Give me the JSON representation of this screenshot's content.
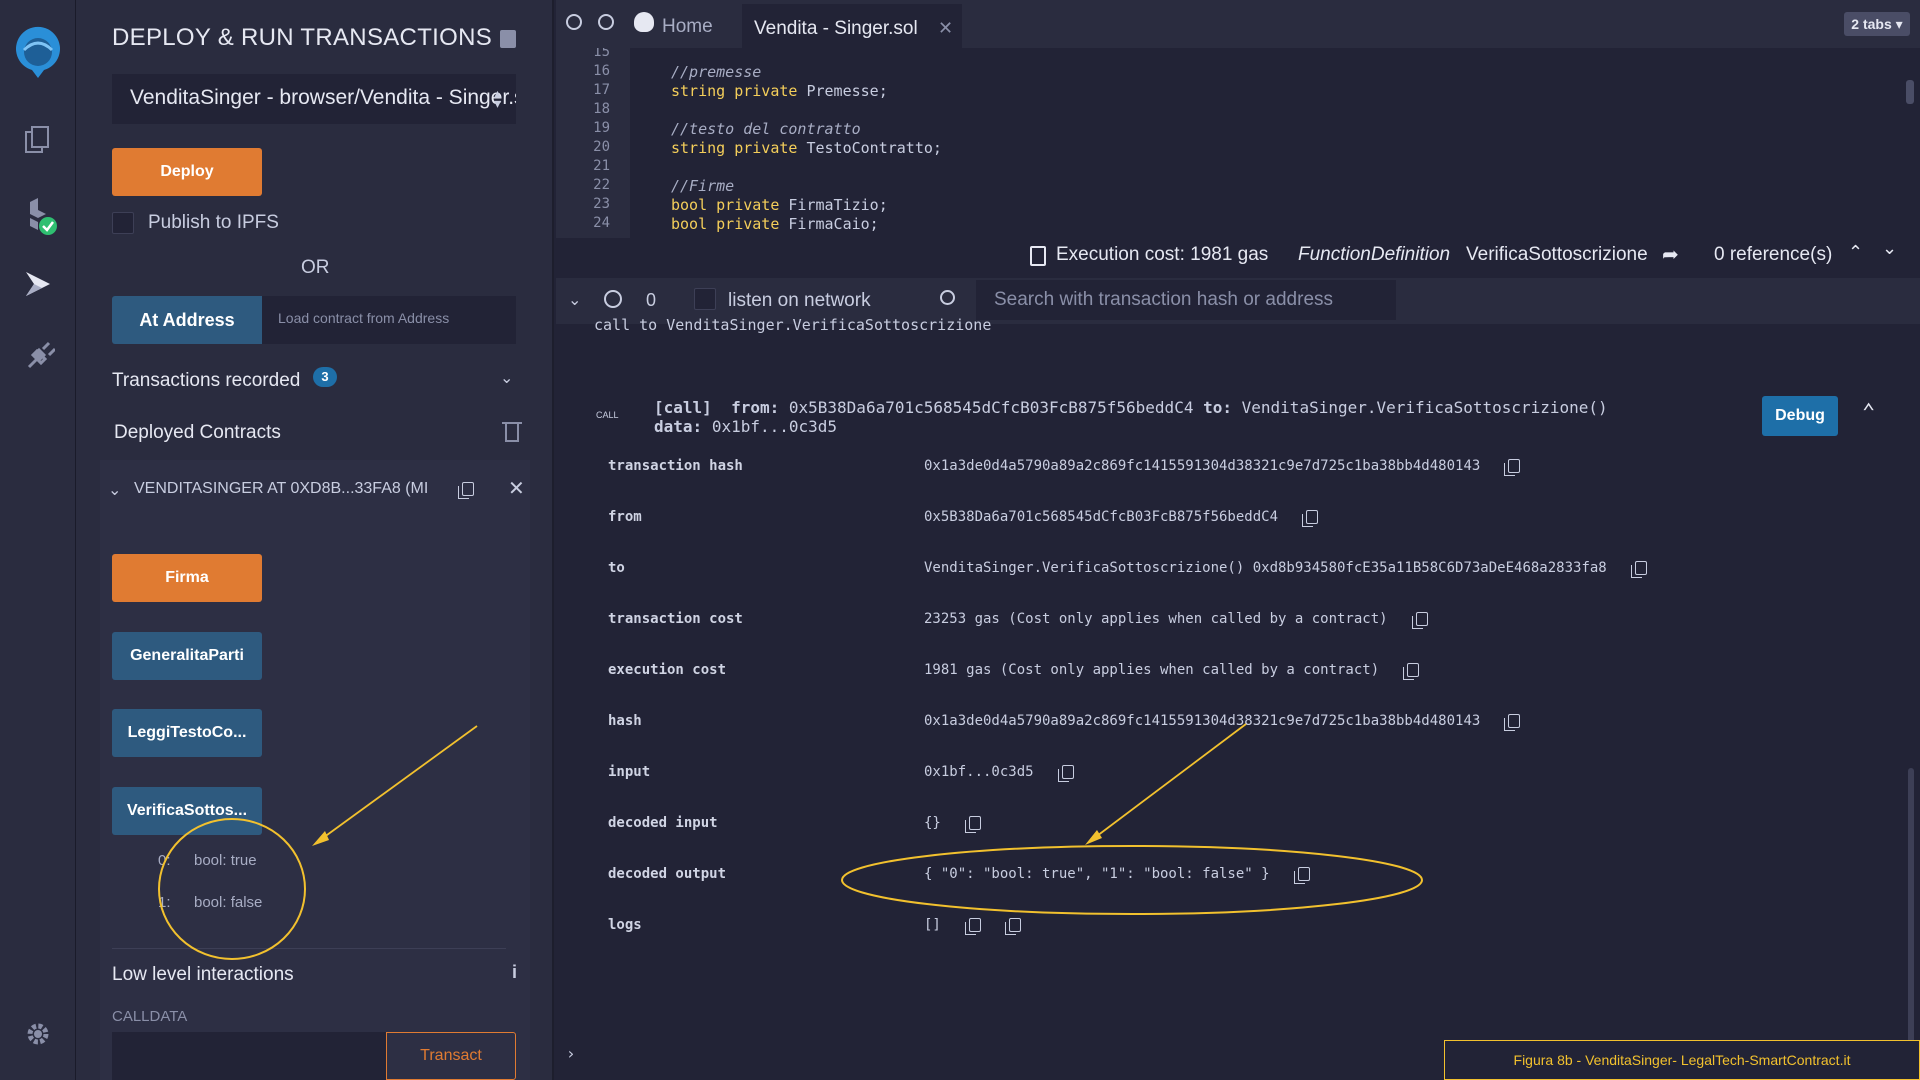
{
  "sidebar_title": "DEPLOY & RUN TRANSACTIONS",
  "contract_select": "VenditaSinger - browser/Vendita - Singer.sol",
  "deploy_label": "Deploy",
  "publish_ipfs_label": "Publish to IPFS",
  "or_label": "OR",
  "at_address_label": "At Address",
  "load_contract_placeholder": "Load contract from Address",
  "transactions_recorded_label": "Transactions recorded",
  "transactions_recorded_count": "3",
  "deployed_contracts_label": "Deployed Contracts",
  "deployed_instance_label": "VENDITASINGER AT 0XD8B...33FA8 (MI",
  "functions": [
    {
      "label": "Firma",
      "style": "orange"
    },
    {
      "label": "GeneralitaParti",
      "style": "blue"
    },
    {
      "label": "LeggiTestoCo...",
      "style": "blue"
    },
    {
      "label": "VerificaSottos...",
      "style": "blue"
    }
  ],
  "results": [
    {
      "index": "0:",
      "value": "bool: true"
    },
    {
      "index": "1:",
      "value": "bool: false"
    }
  ],
  "low_level_label": "Low level interactions",
  "calldata_label": "CALLDATA",
  "transact_label": "Transact",
  "tabs": {
    "home_label": "Home",
    "file_label": "Vendita - Singer.sol",
    "tabs_count_label": "2 tabs"
  },
  "code_lines": [
    {
      "n": "15",
      "text": ""
    },
    {
      "n": "16",
      "text": "//premesse",
      "type": "comment"
    },
    {
      "n": "17",
      "kw": "string private",
      "rest": " Premesse;"
    },
    {
      "n": "18",
      "text": ""
    },
    {
      "n": "19",
      "text": "//testo del contratto",
      "type": "comment"
    },
    {
      "n": "20",
      "kw": "string private",
      "rest": " TestoContratto;"
    },
    {
      "n": "21",
      "text": ""
    },
    {
      "n": "22",
      "text": "//Firme",
      "type": "comment"
    },
    {
      "n": "23",
      "kw": "bool private",
      "rest": " FirmaTizio;"
    },
    {
      "n": "24",
      "kw": "bool private",
      "rest": " FirmaCaio;"
    }
  ],
  "status": {
    "execution_cost": "Execution cost: 1981 gas",
    "function_definition_label": "FunctionDefinition",
    "function_name": "VerificaSottoscrizione",
    "references": "0 reference(s)"
  },
  "terminal": {
    "counter": "0",
    "listen_label": "listen on network",
    "search_placeholder": "Search with transaction hash or address",
    "prev_line": "call to VenditaSinger.VerificaSottoscrizione",
    "call_badge": "CALL",
    "call_tag": "[call]",
    "from_label": "from:",
    "from_value": "0x5B38Da6a701c568545dCfcB03FcB875f56beddC4",
    "to_label": "to:",
    "to_value": "VenditaSinger.VerificaSottoscrizione()",
    "data_label": "data:",
    "data_value": "0x1bf...0c3d5",
    "debug_label": "Debug",
    "rows": [
      {
        "key": "transaction hash",
        "value": "0x1a3de0d4a5790a89a2c869fc1415591304d38321c9e7d725c1ba38bb4d480143"
      },
      {
        "key": "from",
        "value": "0x5B38Da6a701c568545dCfcB03FcB875f56beddC4"
      },
      {
        "key": "to",
        "value": "VenditaSinger.VerificaSottoscrizione() 0xd8b934580fcE35a11B58C6D73aDeE468a2833fa8"
      },
      {
        "key": "transaction cost",
        "value": "23253 gas (Cost only applies when called by a contract)"
      },
      {
        "key": "execution cost",
        "value": "1981 gas (Cost only applies when called by a contract)"
      },
      {
        "key": "hash",
        "value": "0x1a3de0d4a5790a89a2c869fc1415591304d38321c9e7d725c1ba38bb4d480143"
      },
      {
        "key": "input",
        "value": "0x1bf...0c3d5"
      },
      {
        "key": "decoded input",
        "value": "{}"
      },
      {
        "key": "decoded output",
        "value": "{ \"0\": \"bool: true\", \"1\": \"bool: false\" }"
      },
      {
        "key": "logs",
        "value": "[]"
      }
    ]
  },
  "caption": "Figura 8b - VenditaSinger- LegalTech-SmartContract.it",
  "colors": {
    "accent_orange": "#e07b32",
    "accent_blue": "#2e5a7f",
    "annotation_yellow": "#f2c12e",
    "debug_blue": "#1e6fa8"
  }
}
